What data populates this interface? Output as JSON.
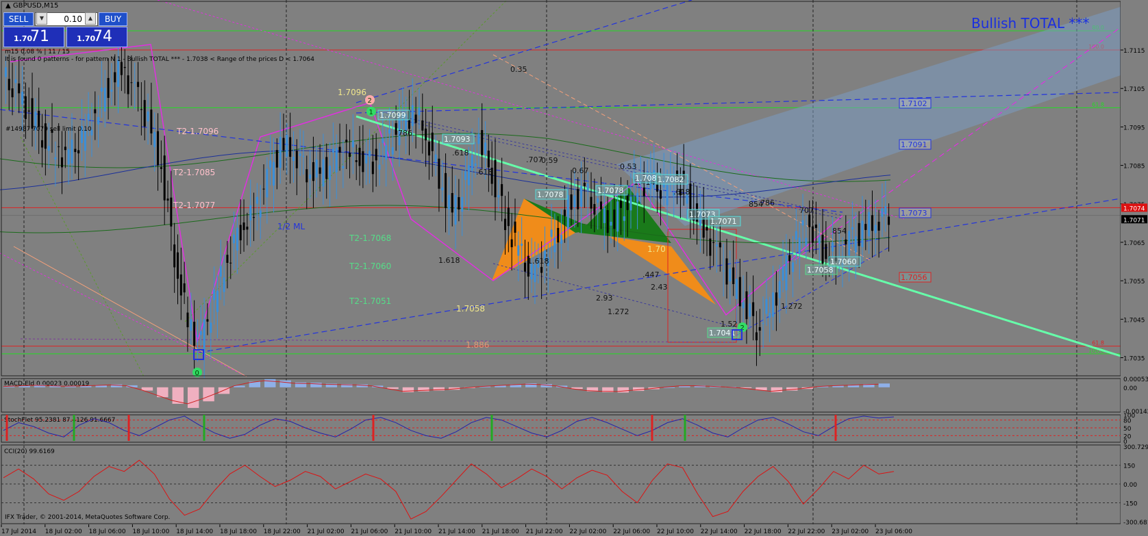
{
  "window": {
    "symbol_title": "GBPUSD,M15",
    "info_line": "m15  0.08 %  | 11 / 15",
    "pattern_line": "It is found 0 patterns  -  for pattern N 1 - Bullish TOTAL ***  - 1.7038 < Range of the prices D < 1.7064",
    "pattern_title": "Bullish TOTAL ***",
    "order_label": "#14987 7079 sell limit 0.10",
    "copyright": "IFX Trader, © 2001-2014, MetaQuotes Software Corp."
  },
  "trade_panel": {
    "sell_label": "SELL",
    "buy_label": "BUY",
    "lot_value": "0.10",
    "sell_price_small": "1.70",
    "sell_price_big": "71",
    "buy_price_small": "1.70",
    "buy_price_big": "74"
  },
  "chart_data": [
    {
      "type": "candlestick",
      "name": "GBPUSD,M15",
      "x_labels": [
        "17 Jul 2014",
        "18 Jul 02:00",
        "18 Jul 06:00",
        "18 Jul 10:00",
        "18 Jul 14:00",
        "18 Jul 18:00",
        "18 Jul 22:00",
        "21 Jul 02:00",
        "21 Jul 06:00",
        "21 Jul 10:00",
        "21 Jul 14:00",
        "21 Jul 18:00",
        "21 Jul 22:00",
        "22 Jul 02:00",
        "22 Jul 06:00",
        "22 Jul 10:00",
        "22 Jul 14:00",
        "22 Jul 18:00",
        "22 Jul 22:00",
        "23 Jul 02:00",
        "23 Jul 06:00"
      ],
      "y_ticks": [
        "1.7115",
        "1.7105",
        "1.7095",
        "1.7085",
        "1.7075",
        "1.7065",
        "1.7055",
        "1.7045",
        "1.7035"
      ],
      "ylim": [
        1.7031,
        1.7128
      ],
      "current_price": "1.7071",
      "red_price_tag": "1.7074",
      "price_path": [
        1.7108,
        1.7104,
        1.7099,
        1.7093,
        1.7089,
        1.7087,
        1.7092,
        1.7099,
        1.7106,
        1.711,
        1.7104,
        1.7096,
        1.7085,
        1.7062,
        1.7044,
        1.7039,
        1.705,
        1.7061,
        1.7069,
        1.7072,
        1.7081,
        1.709,
        1.7089,
        1.7084,
        1.7083,
        1.7086,
        1.7089,
        1.7087,
        1.7086,
        1.709,
        1.7095,
        1.7099,
        1.7094,
        1.7082,
        1.7072,
        1.708,
        1.7092,
        1.7083,
        1.7071,
        1.7063,
        1.7056,
        1.7062,
        1.7068,
        1.7076,
        1.7078,
        1.7073,
        1.707,
        1.7075,
        1.708,
        1.7081,
        1.7078,
        1.7082,
        1.7075,
        1.7068,
        1.7062,
        1.7055,
        1.705,
        1.7043,
        1.7048,
        1.7056,
        1.7065,
        1.707,
        1.7063,
        1.7061,
        1.7065,
        1.7068,
        1.7071,
        1.7073
      ],
      "horizontal_levels": [
        {
          "price": 1.712,
          "color": "#22dd22",
          "label": "80.0"
        },
        {
          "price": 1.7115,
          "color": "#dd2222",
          "label": "100.0"
        },
        {
          "price": 1.71,
          "color": "#22dd22",
          "label": "61.8"
        },
        {
          "price": 1.7074,
          "color": "#dd2222",
          "label": ""
        },
        {
          "price": 1.7038,
          "color": "#dd2222",
          "label": "61.8"
        },
        {
          "price": 1.7036,
          "color": "#22dd22",
          "label": "100.0"
        }
      ],
      "boxed_labels": [
        {
          "text": "1.7099",
          "color": "#55dddd"
        },
        {
          "text": "1.7093",
          "color": "#55dddd"
        },
        {
          "text": "1.7078",
          "color": "#55dddd"
        },
        {
          "text": "1.7078",
          "color": "#55dddd"
        },
        {
          "text": "1.708",
          "color": "#55dddd"
        },
        {
          "text": "1.7082",
          "color": "#55dddd"
        },
        {
          "text": "1.7073",
          "color": "#55dddd"
        },
        {
          "text": "1.7071",
          "color": "#55dddd"
        },
        {
          "text": "1.7058",
          "color": "#55dd88"
        },
        {
          "text": "1.7060",
          "color": "#55dddd"
        },
        {
          "text": "1.7041",
          "color": "#55dd88"
        },
        {
          "text": "1.7102",
          "color": "#2233dd"
        },
        {
          "text": "1.7091",
          "color": "#2233dd"
        },
        {
          "text": "1.7073",
          "color": "#2233dd"
        },
        {
          "text": "1.7056",
          "color": "#dd2222"
        }
      ],
      "annotations": [
        {
          "text": "1.7096",
          "color": "#f0e68c"
        },
        {
          "text": "T2-1.7096",
          "color": "#ffc0cb"
        },
        {
          "text": "T2-1.7085",
          "color": "#ffc0cb"
        },
        {
          "text": "T2-1.7077",
          "color": "#ffc0cb"
        },
        {
          "text": "T2-1.7068",
          "color": "#55dd88"
        },
        {
          "text": "T2-1.7060",
          "color": "#55dd88"
        },
        {
          "text": "T2-1.7051",
          "color": "#55dd88"
        },
        {
          "text": "1/2 ML",
          "color": "#2233dd"
        },
        {
          "text": "1.7058",
          "color": "#f0e68c"
        },
        {
          "text": "1.70",
          "color": "#f0e68c"
        },
        {
          "text": "786",
          "color": "#111111"
        },
        {
          "text": ".618",
          "color": "#111111"
        },
        {
          "text": ".618",
          "color": "#111111"
        },
        {
          "text": ".707",
          "color": "#111111"
        },
        {
          "text": "0.59",
          "color": "#111111"
        },
        {
          "text": "0.67",
          "color": "#111111"
        },
        {
          "text": "0.53",
          "color": "#111111"
        },
        {
          "text": "1.414",
          "color": "#111111"
        },
        {
          "text": ".618",
          "color": "#111111"
        },
        {
          "text": "854",
          "color": "#111111"
        },
        {
          "text": "786",
          "color": "#111111"
        },
        {
          "text": "707",
          "color": "#111111"
        },
        {
          "text": "854",
          "color": "#111111"
        },
        {
          "text": "1.618",
          "color": "#111111"
        },
        {
          "text": "1.618",
          "color": "#111111"
        },
        {
          "text": ".447",
          "color": "#111111"
        },
        {
          "text": "2.43",
          "color": "#111111"
        },
        {
          "text": "2.93",
          "color": "#111111"
        },
        {
          "text": "1.272",
          "color": "#111111"
        },
        {
          "text": "1.52",
          "color": "#111111"
        },
        {
          "text": "1.272",
          "color": "#111111"
        },
        {
          "text": "0.35",
          "color": "#111111"
        },
        {
          "text": "1.886",
          "color": "#dd9977"
        },
        {
          "text": "886",
          "color": "#dd3333"
        }
      ],
      "pivot_markers": [
        {
          "text": "1",
          "color": "#33dd66"
        },
        {
          "text": "2",
          "color": "#ffaaaa"
        },
        {
          "text": "0",
          "color": "#33dd66"
        },
        {
          "text": "2",
          "color": "#33dd66"
        }
      ]
    },
    {
      "type": "bar",
      "name": "MACD-Eld",
      "label": "MACD-Eld 0.00023 0.00019",
      "y_ticks": [
        "0.00053",
        "0.00",
        "-0.00142"
      ],
      "values": [
        6e-05,
        0.0001,
        0.00015,
        0.00012,
        8e-05,
        0.0001,
        0.00014,
        0.00018,
        0.00012,
        -0.0002,
        -0.0006,
        -0.001,
        -0.00125,
        -0.00085,
        -0.0004,
        0.0001,
        0.00035,
        0.0005,
        0.00042,
        0.0003,
        0.00028,
        0.00022,
        0.0002,
        0.00018,
        0.0001,
        -0.0001,
        -0.0003,
        -0.00025,
        -0.0002,
        -0.00015,
        -5e-05,
        5e-05,
        0.00012,
        0.00018,
        0.00024,
        0.0002,
        0.0001,
        -0.0001,
        -0.00025,
        -0.0003,
        -0.00032,
        -0.00022,
        -0.00012,
        0.0,
        0.0001,
        0.00012,
        8e-05,
        3e-05,
        -5e-05,
        -0.00018,
        -0.0003,
        -0.0002,
        -0.0001,
        5e-05,
        0.00012,
        0.00016,
        0.0002,
        0.00023
      ]
    },
    {
      "type": "line",
      "name": "StochFlet",
      "label": "StochFlet 95.2381 87.4126 91.6667",
      "y_ticks": [
        "100",
        "80",
        "50",
        "20",
        "0"
      ],
      "ylim": [
        0,
        100
      ],
      "values": [
        40,
        70,
        55,
        30,
        15,
        60,
        85,
        70,
        40,
        20,
        50,
        80,
        95,
        60,
        30,
        10,
        25,
        60,
        85,
        75,
        50,
        30,
        15,
        45,
        80,
        90,
        70,
        40,
        20,
        10,
        35,
        70,
        90,
        80,
        55,
        30,
        15,
        40,
        75,
        90,
        70,
        45,
        20,
        40,
        70,
        85,
        60,
        30,
        15,
        50,
        80,
        90,
        65,
        35,
        20,
        55,
        85,
        95,
        88,
        92
      ]
    },
    {
      "type": "line",
      "name": "CCI(20)",
      "label": "CCI(20) 99.6169",
      "y_ticks": [
        "300.7294",
        "150",
        "0.00",
        "-150",
        "-300.681"
      ],
      "ylim": [
        -300.681,
        300.7294
      ],
      "values": [
        50,
        120,
        40,
        -80,
        -130,
        -60,
        60,
        140,
        100,
        190,
        80,
        -120,
        -250,
        -200,
        -50,
        80,
        150,
        60,
        -20,
        30,
        100,
        60,
        -40,
        20,
        80,
        40,
        -60,
        -280,
        -220,
        -100,
        30,
        160,
        80,
        -30,
        40,
        120,
        60,
        -40,
        50,
        110,
        70,
        -60,
        -150,
        30,
        160,
        130,
        -80,
        -260,
        -220,
        -60,
        60,
        140,
        20,
        -160,
        -40,
        100,
        40,
        150,
        80,
        100
      ]
    }
  ]
}
